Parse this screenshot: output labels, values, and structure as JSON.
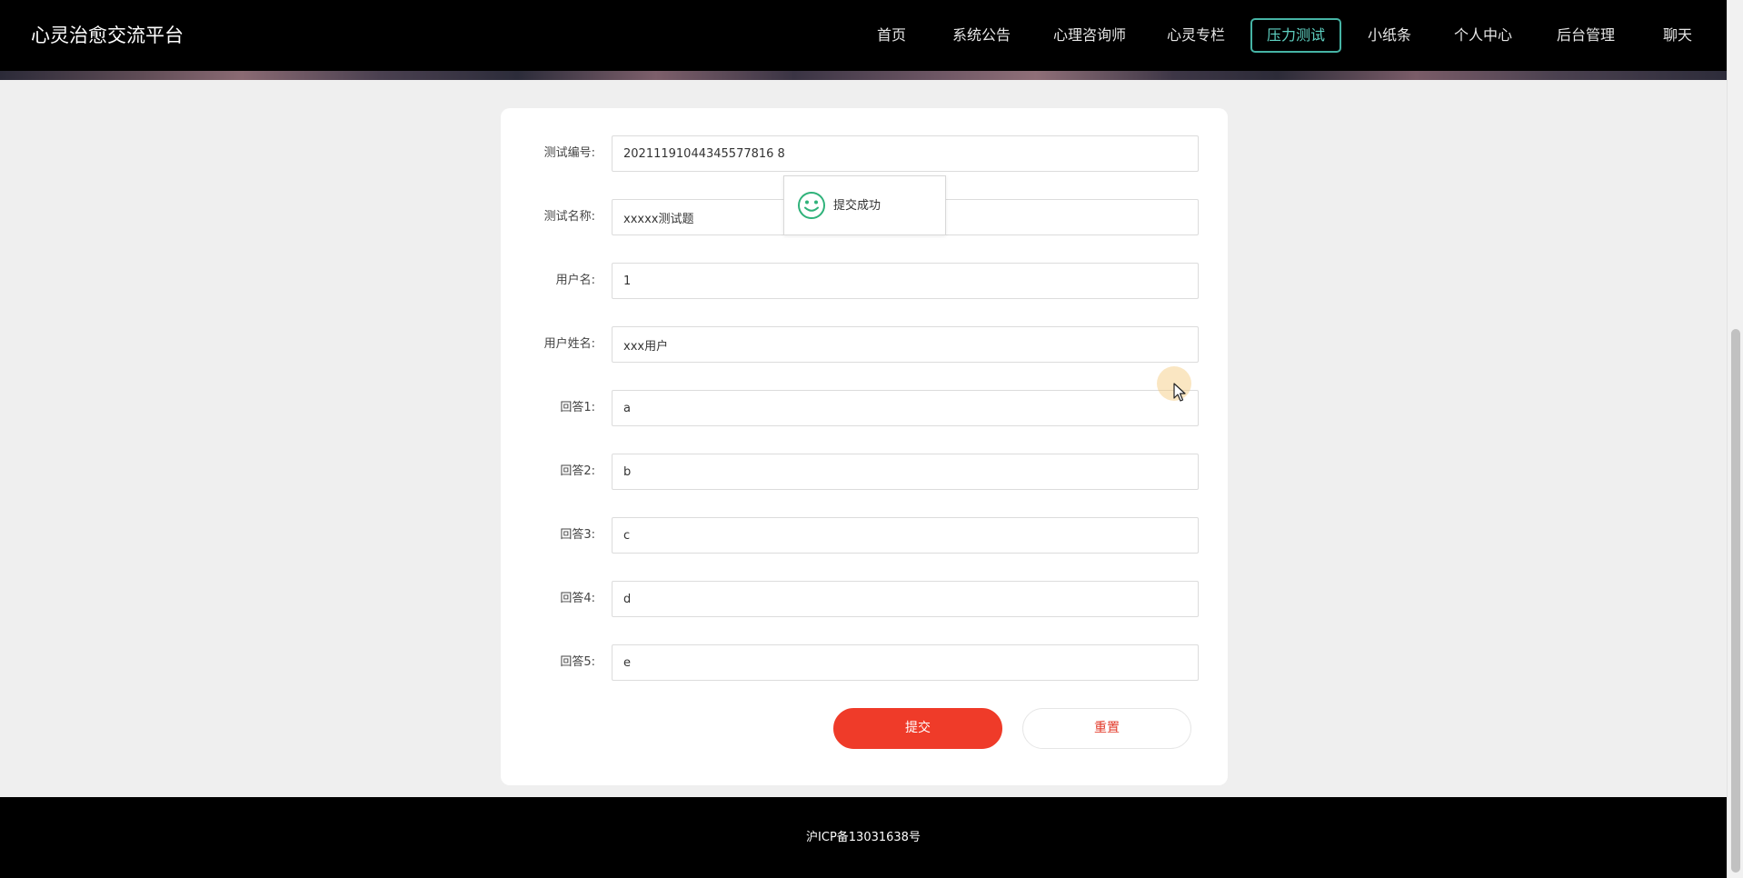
{
  "header": {
    "logo": "心灵治愈交流平台",
    "nav": [
      {
        "label": "首页"
      },
      {
        "label": "系统公告"
      },
      {
        "label": "心理咨询师"
      },
      {
        "label": "心灵专栏"
      },
      {
        "label": "压力测试",
        "active": true
      },
      {
        "label": "小纸条"
      },
      {
        "label": "个人中心"
      },
      {
        "label": "后台管理"
      },
      {
        "label": "聊天"
      }
    ]
  },
  "form": {
    "fields": [
      {
        "label": "测试编号:",
        "value": "20211191044345577816 8"
      },
      {
        "label": "测试名称:",
        "value": "xxxxx测试题"
      },
      {
        "label": "用户名:",
        "value": "1"
      },
      {
        "label": "用户姓名:",
        "value": "xxx用户"
      },
      {
        "label": "回答1:",
        "value": "a"
      },
      {
        "label": "回答2:",
        "value": "b"
      },
      {
        "label": "回答3:",
        "value": "c"
      },
      {
        "label": "回答4:",
        "value": "d"
      },
      {
        "label": "回答5:",
        "value": "e"
      }
    ],
    "submit_label": "提交",
    "reset_label": "重置"
  },
  "toast": {
    "text": "提交成功",
    "icon": "smiley-icon",
    "color": "#2fb27a"
  },
  "footer": {
    "icp": "沪ICP备13031638号"
  },
  "colors": {
    "accent": "#46b4a5",
    "primary_button": "#ef3b29",
    "header_bg": "#000000"
  }
}
